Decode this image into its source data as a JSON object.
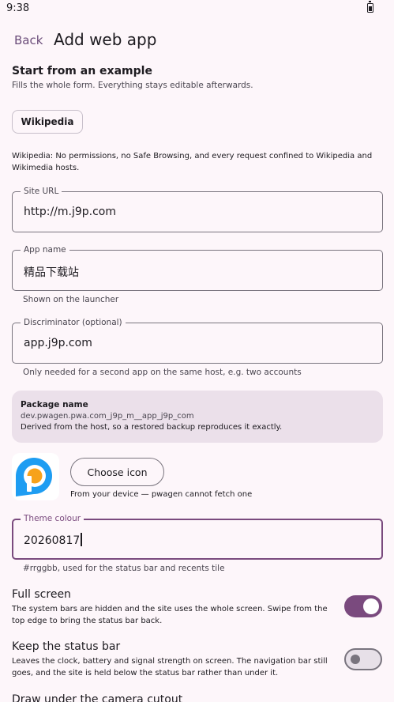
{
  "status_bar": {
    "time": "9:38"
  },
  "app_bar": {
    "back_label": "Back",
    "title": "Add web app"
  },
  "example_section": {
    "heading": "Start from an example",
    "subtitle": "Fills the whole form. Everything stays editable afterwards.",
    "chip_label": "Wikipedia",
    "chip_description": "Wikipedia: No permissions, no Safe Browsing, and every request confined to Wikipedia and Wikimedia hosts."
  },
  "form": {
    "site_url": {
      "label": "Site URL",
      "value": "http://m.j9p.com"
    },
    "app_name": {
      "label": "App name",
      "value": "精品下载站",
      "helper": "Shown on the launcher"
    },
    "discriminator": {
      "label": "Discriminator (optional)",
      "value": "app.j9p.com",
      "helper": "Only needed for a second app on the same host, e.g. two accounts"
    },
    "theme_colour": {
      "label": "Theme colour",
      "value": "20260817",
      "helper": "#rrggbb, used for the status bar and recents tile"
    }
  },
  "package": {
    "title": "Package name",
    "id": "dev.pwagen.pwa.com_j9p_m__app_j9p_com",
    "note": "Derived from the host, so a restored backup reproduces it exactly."
  },
  "icon": {
    "button_label": "Choose icon",
    "note": "From your device — pwagen cannot fetch one",
    "app_icon": "p-logo-icon"
  },
  "settings": [
    {
      "title": "Full screen",
      "description": "The system bars are hidden and the site uses the whole screen. Swipe from the top edge to bring the status bar back.",
      "enabled": true
    },
    {
      "title": "Keep the status bar",
      "description": "Leaves the clock, battery and signal strength on screen. The navigation bar still goes, and the site is held below the status bar rather than under it.",
      "enabled": false
    },
    {
      "title": "Draw under the camera cutout"
    }
  ],
  "colors": {
    "accent": "#7a4a7e",
    "background": "#fdf6fa",
    "card": "#ebe0ea",
    "logo_blue": "#1e9df2",
    "logo_orange": "#f7a21b"
  }
}
